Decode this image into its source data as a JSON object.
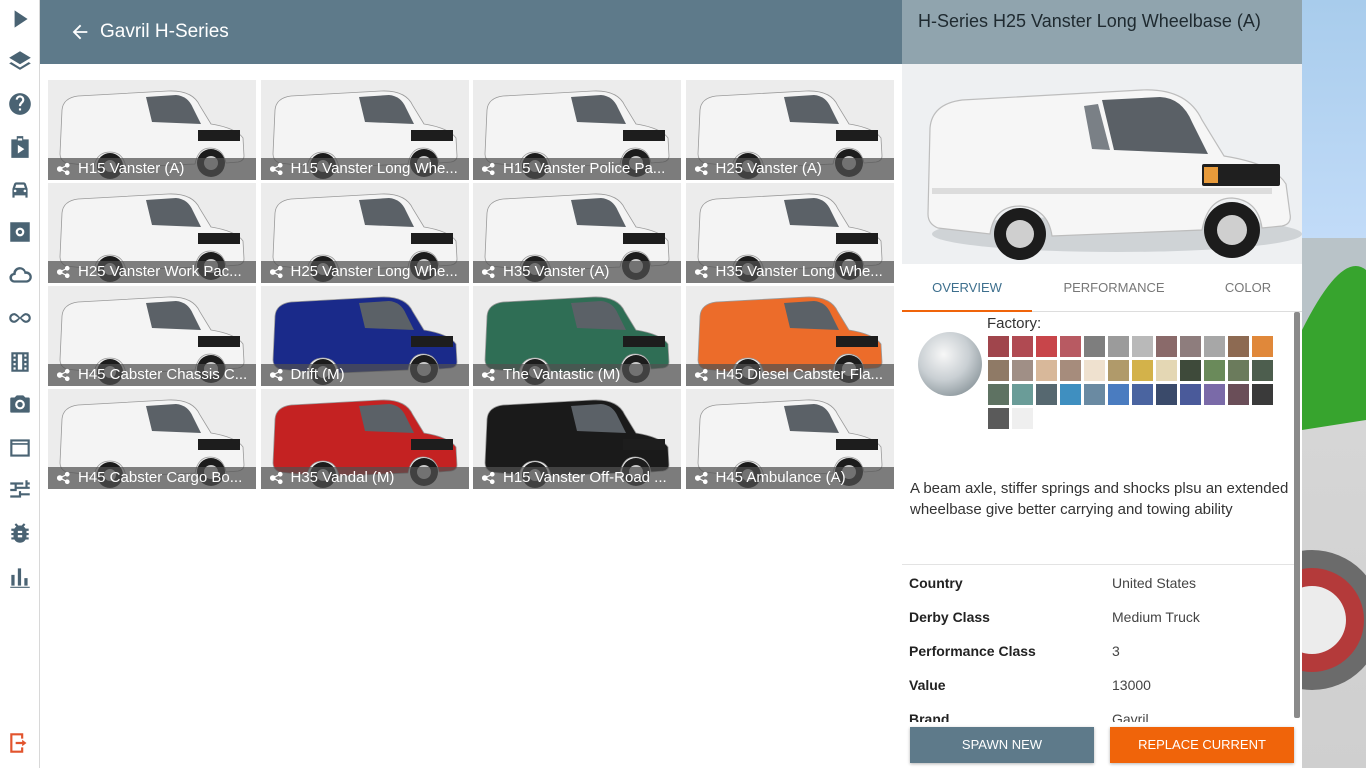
{
  "header": {
    "title": "Gavril H-Series"
  },
  "sidebar": {
    "items": [
      "play-icon",
      "layers-icon",
      "help-icon",
      "mission-icon",
      "vehicle-icon",
      "settings-icon",
      "cloud-icon",
      "infinity-icon",
      "film-icon",
      "camera-icon",
      "window-icon",
      "sliders-icon",
      "bug-icon",
      "stats-icon",
      "exit-icon"
    ]
  },
  "grid": {
    "tiles": [
      {
        "label": "H15 Vanster (A)",
        "color": "#f4f4f4"
      },
      {
        "label": "H15 Vanster Long Whe...",
        "color": "#f4f4f4"
      },
      {
        "label": "H15 Vanster Police Pa...",
        "color": "#f4f4f4"
      },
      {
        "label": "H25 Vanster (A)",
        "color": "#f4f4f4"
      },
      {
        "label": "H25 Vanster Work Pac...",
        "color": "#f4f4f4"
      },
      {
        "label": "H25 Vanster Long Whe...",
        "color": "#f4f4f4"
      },
      {
        "label": "H35 Vanster (A)",
        "color": "#f4f4f4"
      },
      {
        "label": "H35 Vanster Long Whe...",
        "color": "#f4f4f4"
      },
      {
        "label": "H45 Cabster Chassis C...",
        "color": "#f4f4f4"
      },
      {
        "label": "Drift (M)",
        "color": "#1a2a8a"
      },
      {
        "label": "The Vantastic (M)",
        "color": "#2f6e55"
      },
      {
        "label": "H45 Diesel Cabster Fla...",
        "color": "#ec6c2a"
      },
      {
        "label": "H45 Cabster Cargo Bo...",
        "color": "#f4f4f4"
      },
      {
        "label": "H35 Vandal (M)",
        "color": "#c42222"
      },
      {
        "label": "H15 Vanster Off-Road ...",
        "color": "#1a1a1a"
      },
      {
        "label": "H45 Ambulance (A)",
        "color": "#f4f4f4"
      }
    ]
  },
  "detail": {
    "title": "H-Series H25 Vanster Long Wheelbase (A)",
    "tabs": [
      "OVERVIEW",
      "PERFORMANCE",
      "COLOR"
    ],
    "active_tab": "OVERVIEW",
    "factory_label": "Factory:",
    "swatches": [
      "#a0454c",
      "#b04a52",
      "#c8454a",
      "#b85a62",
      "#7e7e7e",
      "#9b9b9b",
      "#b9b9b9",
      "#8a6a6a",
      "#8e7d7d",
      "#a7a7a7",
      "#8d6a52",
      "#e0883a",
      "#8f7a66",
      "#a08f86",
      "#d8b89a",
      "#a68c7c",
      "#efe1cf",
      "#b09a6a",
      "#d3b24a",
      "#e4d7b4",
      "#3e4a3a",
      "#6a8a5a",
      "#6b7b5c",
      "#4d5e4e",
      "#5e7262",
      "#6a9c98",
      "#566870",
      "#3f8fc0",
      "#6a8aa2",
      "#4a7cc0",
      "#4a64a0",
      "#3a4a6a",
      "#4a5a9a",
      "#7a6aa8",
      "#6a4e58",
      "#3a3a3a",
      "#5a5a5a",
      "#efefef"
    ],
    "description": "A beam axle, stiffer springs and shocks plsu an extended wheelbase give better carrying and towing ability",
    "specs": [
      {
        "key": "Country",
        "value": "United States"
      },
      {
        "key": "Derby Class",
        "value": "Medium Truck"
      },
      {
        "key": "Performance Class",
        "value": "3"
      },
      {
        "key": "Value",
        "value": "13000"
      },
      {
        "key": "Brand",
        "value": "Gavril"
      }
    ],
    "spawn_label": "SPAWN NEW",
    "replace_label": "REPLACE CURRENT"
  },
  "colors": {
    "header": "#5e7a8a",
    "accent": "#f0640a",
    "tab_active": "#3d6f8d"
  }
}
